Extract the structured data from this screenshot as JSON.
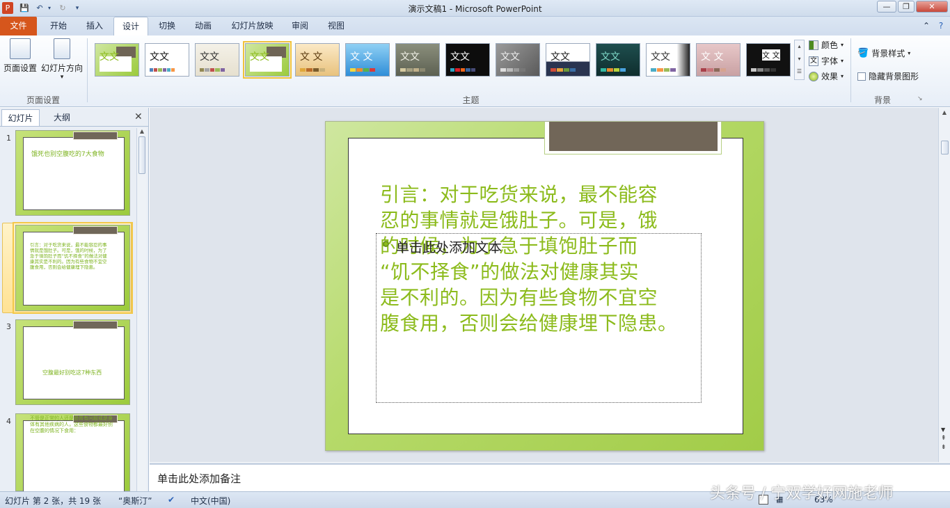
{
  "window": {
    "title": "演示文稿1 - Microsoft PowerPoint"
  },
  "qat": {
    "undo": "↶",
    "redo": "↻"
  },
  "tabs": [
    "文件",
    "开始",
    "插入",
    "设计",
    "切换",
    "动画",
    "幻灯片放映",
    "审阅",
    "视图"
  ],
  "ribbon": {
    "page_setup": {
      "btn_setup": "页面设置",
      "btn_orientation": "幻灯片方向",
      "group_label": "页面设置"
    },
    "themes": {
      "group_label": "主题",
      "sample_text": "文文",
      "sample_text_alt": "文 文"
    },
    "theme_opts": {
      "colors": "颜色",
      "fonts": "字体",
      "effects": "效果"
    },
    "background": {
      "styles": "背景样式",
      "hide_graphics": "隐藏背景图形",
      "group_label": "背景"
    }
  },
  "left_pane": {
    "tab_slides": "幻灯片",
    "tab_outline": "大纲",
    "slides": [
      {
        "num": "1",
        "text": "饿死也别空腹吃的7大食物"
      },
      {
        "num": "2",
        "text": "引言：对于吃货来说，最不能容忍的事情就是饿肚子。可是，饿的时候，为了急于填饱肚子而“饥不择食”的做法对健康其实是不利的。因为有些食物不宜空腹食用，否则会给健康埋下隐患。"
      },
      {
        "num": "3",
        "text": "空腹最好别吃这7种东西"
      },
      {
        "num": "4",
        "text": "不管是正常的人还是肠胃有问题或是身体有其他疾病的人，这些食物都最好别在空腹的情况下食用："
      }
    ]
  },
  "slide": {
    "body_lines": [
      "引言：对于吃货来说，最不能容",
      "忍的事情就是饿肚子。可是，饿",
      "的时候，为了急于填饱肚子而",
      "“饥不择食”的做法对健康其实",
      "是不利的。因为有些食物不宜空",
      "腹食用，否则会给健康埋下隐患。"
    ],
    "placeholder": "单击此处添加文本"
  },
  "notes": {
    "placeholder": "单击此处添加备注"
  },
  "status": {
    "slide_info": "幻灯片 第 2 张，共 19 张",
    "theme": "“奥斯汀”",
    "lang": "中文(中国)",
    "zoom": "63%"
  },
  "watermark": "头条号 / 宁双学好网施老师",
  "colors": {
    "file_tab": "#d6561c",
    "slide_text": "#8cbb1c",
    "selection": "#f0c23b"
  }
}
